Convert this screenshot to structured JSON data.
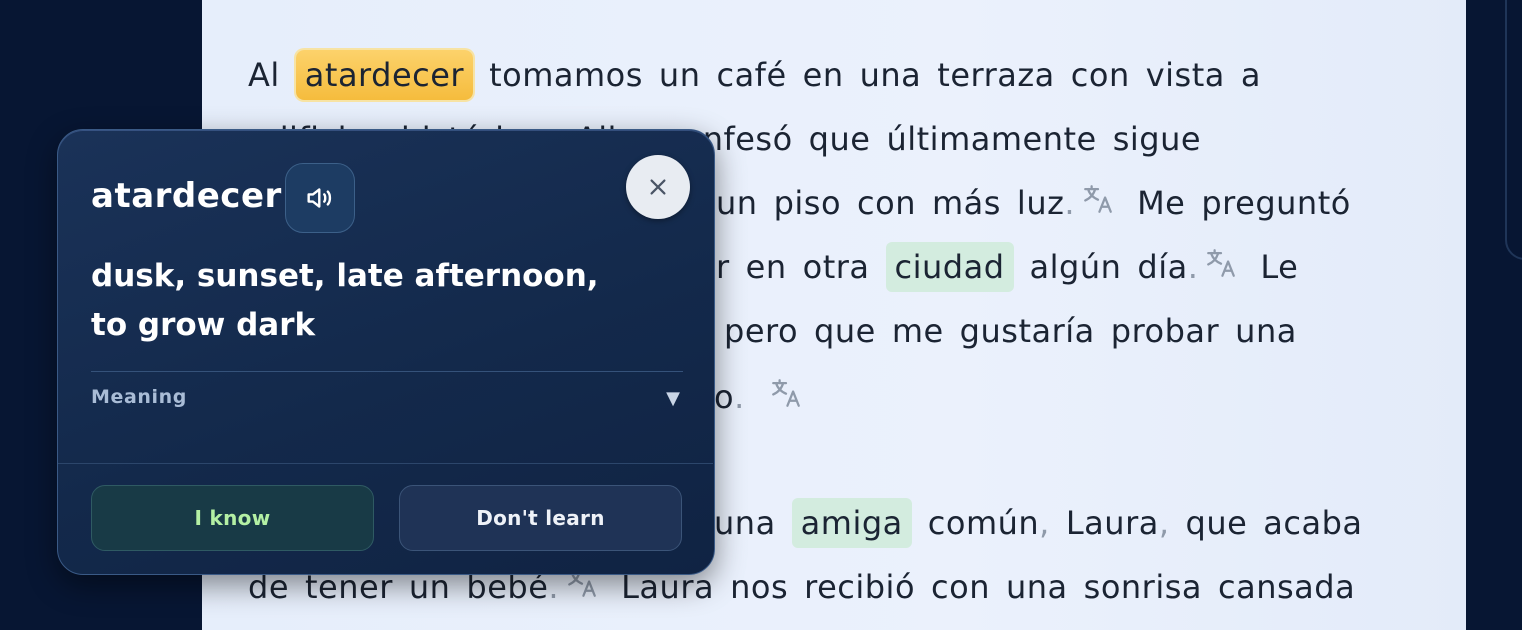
{
  "reader": {
    "line1": {
      "w1": "Al",
      "w2": "atardecer",
      "w3": "tomamos",
      "w4": "un",
      "w5": "café",
      "w6": "en",
      "w7": "una",
      "w8": "terraza",
      "w9": "con",
      "w10": "vista",
      "w11": "a"
    },
    "line2": {
      "w1": "edificios históricos",
      "w2": "Alba",
      "w3": "confesó",
      "w4": "que",
      "w5": "últimamente",
      "w6": "sigue"
    },
    "line3": {
      "w1": "un",
      "w2": "piso",
      "w3": "con",
      "w4": "más",
      "w5": "luz",
      "p1": ".",
      "w6": "Me",
      "w7": "preguntó"
    },
    "line4": {
      "w1": "r",
      "w2": "en",
      "w3": "otra",
      "w4": "ciudad",
      "w5": "algún",
      "w6": "día",
      "p1": ".",
      "w7": "Le"
    },
    "line5": {
      "w1": "pero",
      "w2": "que",
      "w3": "me",
      "w4": "gustaría",
      "w5": "probar",
      "w6": "una"
    },
    "line6": {
      "w1": "o",
      "p1": "."
    },
    "line7": {
      "w1": "una",
      "w2": "amiga",
      "w3": "común",
      "p1": ",",
      "w4": "Laura",
      "p2": ",",
      "w5": "que",
      "w6": "acaba"
    },
    "line8": {
      "w1": "de",
      "w2": "tener",
      "w3": "un",
      "w4": "bebé",
      "p1": ".",
      "w5": "Laura",
      "w6": "nos",
      "w7": "recibió",
      "w8": "con",
      "w9": "una",
      "w10": "sonrisa",
      "w11": "cansada"
    }
  },
  "popup": {
    "word": "atardecer",
    "translation_line1": "dusk, sunset, late afternoon,",
    "translation_line2": "to grow dark",
    "meaning_label": "Meaning",
    "meaning_caret": "▼",
    "know_label": "I know",
    "dont_learn_label": "Don't learn"
  },
  "icons": {
    "audio": "speaker-icon",
    "close": "close-icon",
    "translate": "translate-icon"
  },
  "colors": {
    "highlight_current": "#f8c64d",
    "highlight_known": "#d3ecdf",
    "popup_bg": "#13294b",
    "know_text": "#b4f0a4"
  }
}
